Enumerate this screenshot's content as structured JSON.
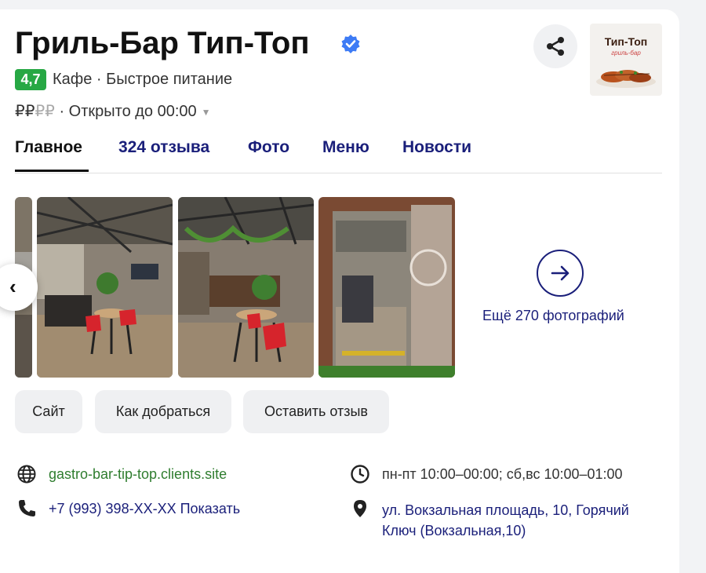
{
  "header": {
    "title": "Гриль-Бар Тип-Топ",
    "rating": "4,7",
    "categories": "Кафе · Быстрое питание",
    "price_active": "₽₽",
    "price_inactive": "₽₽",
    "status": "· Открыто до 00:00",
    "logo_text": "Тип-Топ",
    "logo_sub": "гриль-бар"
  },
  "tabs": [
    "Главное",
    "324 отзыва",
    "Фото",
    "Меню",
    "Новости"
  ],
  "photos": {
    "more_label": "Ещё 270 фотографий"
  },
  "actions": [
    "Сайт",
    "Как добраться",
    "Оставить отзыв"
  ],
  "contacts": {
    "website": "gastro-bar-tip-top.clients.site",
    "phone": "+7 (993) 398-XX-XX Показать",
    "hours": "пн-пт 10:00–00:00; сб,вс 10:00–01:00",
    "address": "ул. Вокзальная площадь, 10, Горячий Ключ (Вокзальная,10)"
  },
  "colors": {
    "rating_bg": "#27a844",
    "link_blue": "#1a1f7a",
    "verified_blue": "#3d7bf5",
    "website_green": "#2f7d2f"
  },
  "icons": [
    "verified-icon",
    "share-icon",
    "chevron-left-icon",
    "arrow-right-icon",
    "globe-icon",
    "phone-icon",
    "clock-icon",
    "location-pin-icon"
  ]
}
